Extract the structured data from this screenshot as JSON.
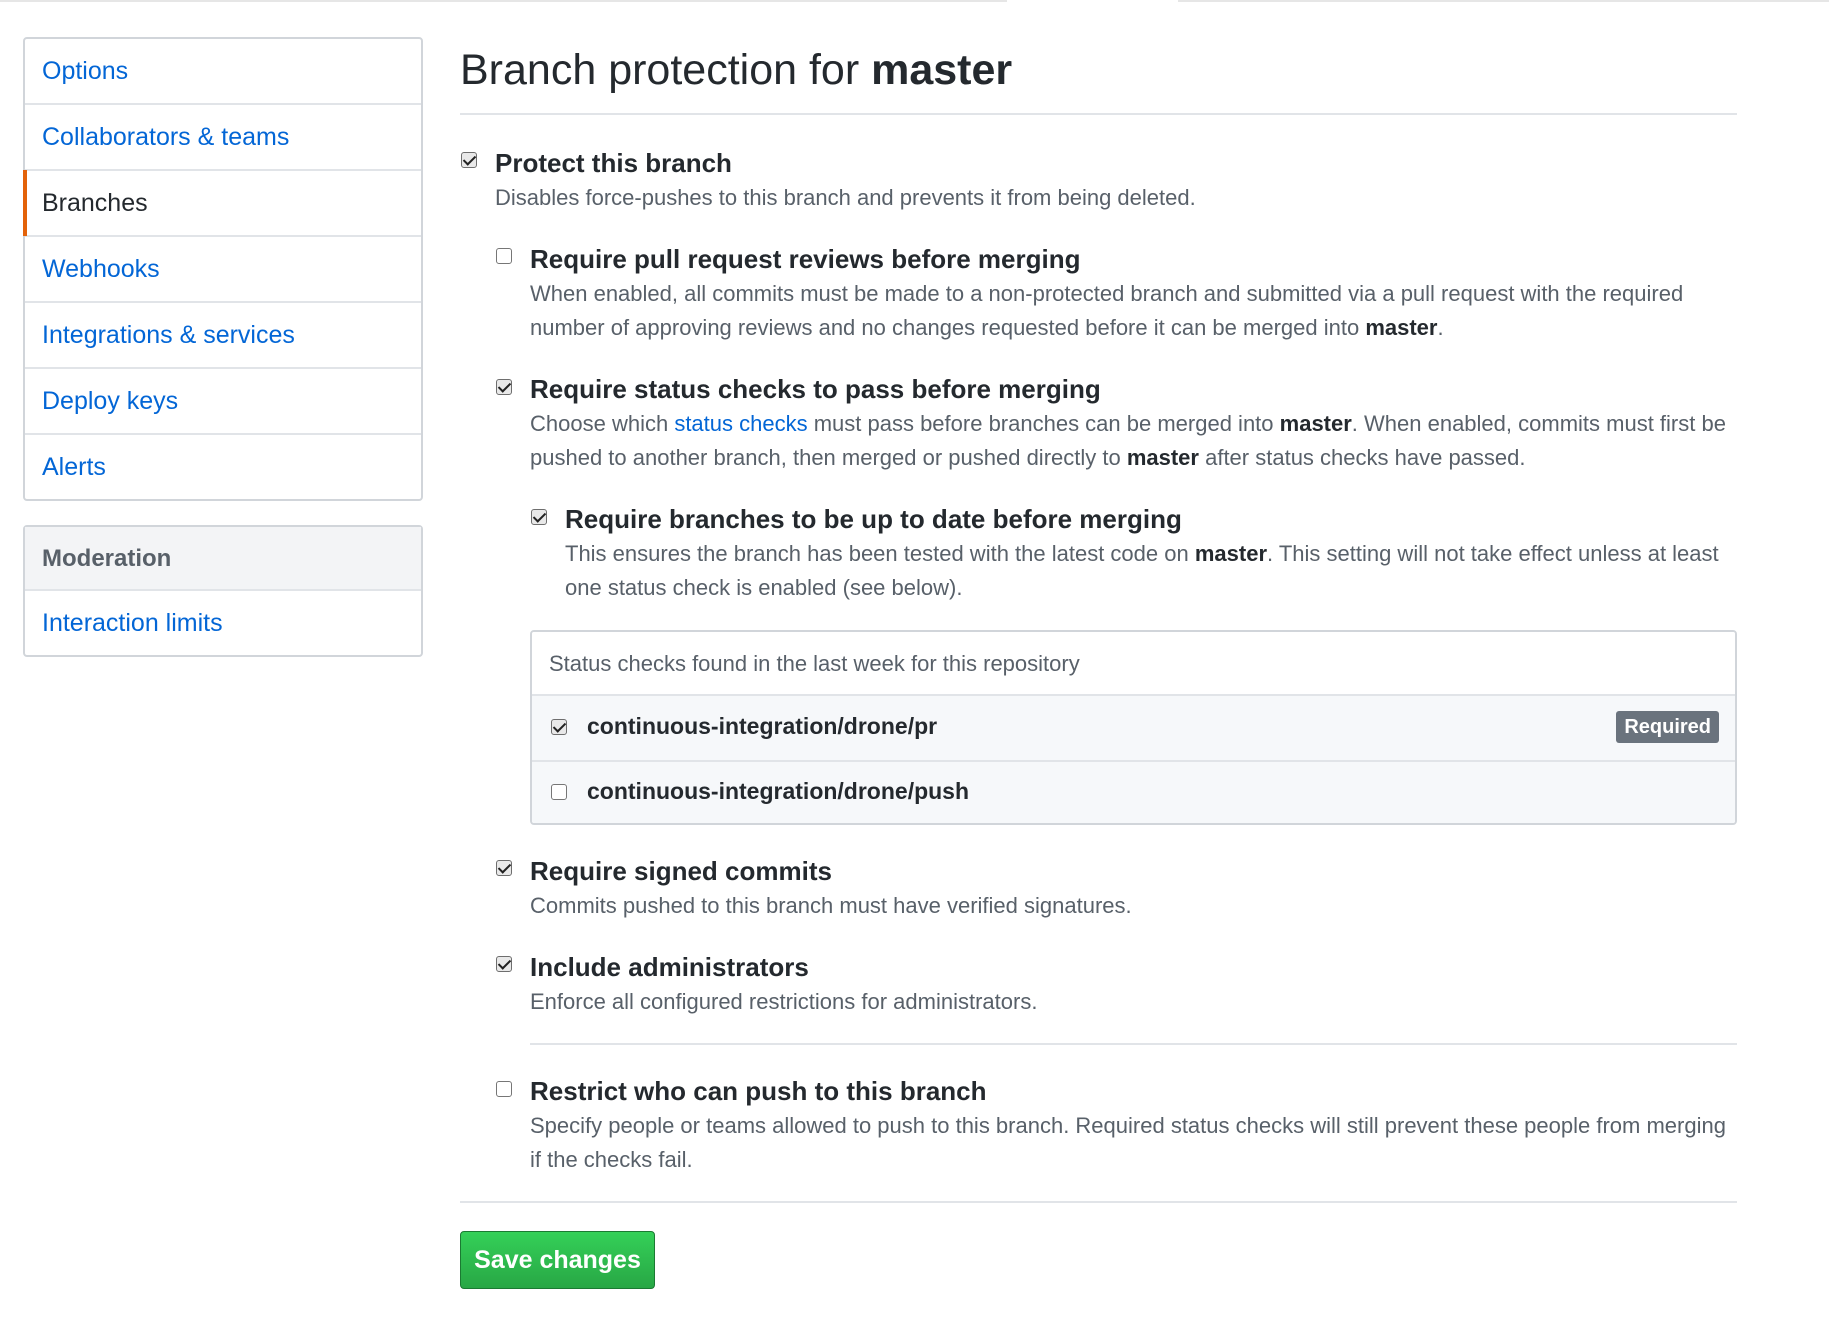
{
  "sidebar": {
    "items": [
      {
        "label": "Options"
      },
      {
        "label": "Collaborators & teams"
      },
      {
        "label": "Branches",
        "selected": true
      },
      {
        "label": "Webhooks"
      },
      {
        "label": "Integrations & services"
      },
      {
        "label": "Deploy keys"
      },
      {
        "label": "Alerts"
      }
    ],
    "moderation": {
      "heading": "Moderation",
      "items": [
        {
          "label": "Interaction limits"
        }
      ]
    }
  },
  "main": {
    "title_prefix": "Branch protection for ",
    "branch": "master",
    "protect": {
      "checked": true,
      "label": "Protect this branch",
      "note": "Disables force-pushes to this branch and prevents it from being deleted."
    },
    "reviews": {
      "checked": false,
      "label": "Require pull request reviews before merging",
      "note_pre": "When enabled, all commits must be made to a non-protected branch and submitted via a pull request with the required number of approving reviews and no changes requested before it can be merged into ",
      "note_post": "."
    },
    "status_checks": {
      "checked": true,
      "label": "Require status checks to pass before merging",
      "note_1": "Choose which ",
      "note_link": "status checks",
      "note_2": " must pass before branches can be merged into ",
      "note_3": ". When enabled, commits must first be pushed to another branch, then merged or pushed directly to ",
      "note_4": " after status checks have passed."
    },
    "up_to_date": {
      "checked": true,
      "label": "Require branches to be up to date before merging",
      "note_pre": "This ensures the branch has been tested with the latest code on ",
      "note_post": ". This setting will not take effect unless at least one status check is enabled (see below)."
    },
    "checks_box": {
      "header": "Status checks found in the last week for this repository",
      "rows": [
        {
          "name": "continuous-integration/drone/pr",
          "checked": true,
          "badge": "Required"
        },
        {
          "name": "continuous-integration/drone/push",
          "checked": false
        }
      ]
    },
    "signed": {
      "checked": true,
      "label": "Require signed commits",
      "note": "Commits pushed to this branch must have verified signatures."
    },
    "admins": {
      "checked": true,
      "label": "Include administrators",
      "note": "Enforce all configured restrictions for administrators."
    },
    "restrict": {
      "checked": false,
      "label": "Restrict who can push to this branch",
      "note": "Specify people or teams allowed to push to this branch. Required status checks will still prevent these people from merging if the checks fail."
    },
    "save_label": "Save changes"
  },
  "colors": {
    "link": "#0366d6",
    "selected_accent": "#e36209",
    "button_green": "#2cbe4e",
    "badge_gray": "#6a737d"
  }
}
